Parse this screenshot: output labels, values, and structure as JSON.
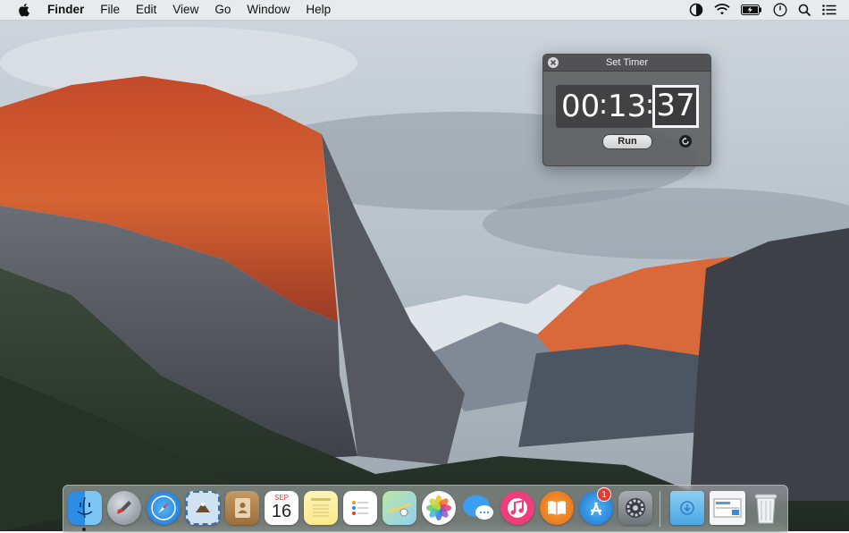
{
  "menubar": {
    "app_name": "Finder",
    "items": [
      "File",
      "Edit",
      "View",
      "Go",
      "Window",
      "Help"
    ],
    "status_icons": [
      "night-shift-icon",
      "wifi-icon",
      "battery-icon",
      "clock-icon",
      "spotlight-icon",
      "notification-center-icon"
    ]
  },
  "timer_window": {
    "title": "Set Timer",
    "hours": "00",
    "minutes": "13",
    "seconds": "37",
    "separator": ":",
    "run_label": "Run"
  },
  "dock": {
    "apps": [
      "finder-icon",
      "launchpad-icon",
      "safari-icon",
      "mail-icon",
      "contacts-icon",
      "calendar-icon",
      "notes-icon",
      "reminders-icon",
      "maps-icon",
      "photos-icon",
      "messages-icon",
      "itunes-icon",
      "ibooks-icon",
      "app-store-icon",
      "system-preferences-icon",
      "downloads-folder-icon",
      "document-stack-icon",
      "trash-icon"
    ],
    "calendar_month": "SEP",
    "calendar_day": "16",
    "app_store_badge": "1"
  }
}
